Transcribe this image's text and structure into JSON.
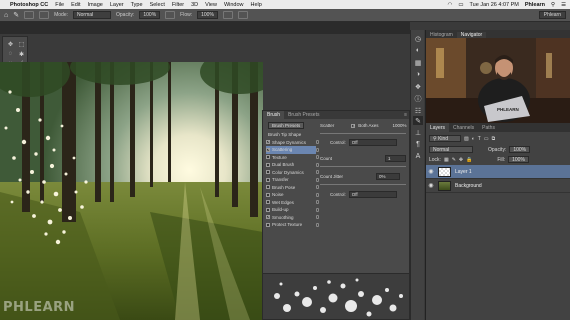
{
  "menubar": {
    "app_name": "Photoshop CC",
    "menus": [
      "File",
      "Edit",
      "Image",
      "Layer",
      "Type",
      "Select",
      "Filter",
      "3D",
      "View",
      "Window",
      "Help"
    ],
    "clock": "Tue Jan 26  4:07 PM",
    "user": "Phlearn"
  },
  "options": {
    "mode_label": "Mode:",
    "mode_value": "Normal",
    "opacity_label": "Opacity:",
    "opacity_value": "100%",
    "flow_label": "Flow:",
    "flow_value": "100%",
    "workspace": "Phlearn"
  },
  "navigator": {
    "tabs": [
      "Histogram",
      "Navigator"
    ],
    "laptop_text": "PHLEARN"
  },
  "layers_panel": {
    "tabs": [
      "Layers",
      "Channels",
      "Paths"
    ],
    "kind_label": "Kind",
    "blend_mode": "Normal",
    "opacity_label": "Opacity:",
    "opacity_value": "100%",
    "lock_label": "Lock:",
    "fill_label": "Fill:",
    "fill_value": "100%",
    "layers": [
      {
        "name": "Layer 1",
        "selected": true
      },
      {
        "name": "Background",
        "selected": false
      }
    ]
  },
  "brush_panel": {
    "tabs": [
      "Brush",
      "Brush Presets"
    ],
    "presets_button": "Brush Presets",
    "items": [
      {
        "label": "Brush Tip Shape",
        "checkbox": false,
        "checked": false,
        "selected": false
      },
      {
        "label": "Shape Dynamics",
        "checkbox": true,
        "checked": true,
        "selected": false
      },
      {
        "label": "Scattering",
        "checkbox": true,
        "checked": true,
        "selected": true
      },
      {
        "label": "Texture",
        "checkbox": true,
        "checked": false,
        "selected": false
      },
      {
        "label": "Dual Brush",
        "checkbox": true,
        "checked": false,
        "selected": false
      },
      {
        "label": "Color Dynamics",
        "checkbox": true,
        "checked": false,
        "selected": false
      },
      {
        "label": "Transfer",
        "checkbox": true,
        "checked": false,
        "selected": false
      },
      {
        "label": "Brush Pose",
        "checkbox": true,
        "checked": false,
        "selected": false
      },
      {
        "label": "Noise",
        "checkbox": true,
        "checked": false,
        "selected": false
      },
      {
        "label": "Wet Edges",
        "checkbox": true,
        "checked": false,
        "selected": false
      },
      {
        "label": "Build-up",
        "checkbox": true,
        "checked": false,
        "selected": false
      },
      {
        "label": "Smoothing",
        "checkbox": true,
        "checked": true,
        "selected": false
      },
      {
        "label": "Protect Texture",
        "checkbox": true,
        "checked": false,
        "selected": false
      }
    ],
    "scatter_label": "Scatter",
    "both_axes_label": "Both Axes",
    "scatter_value": "1000%",
    "control_label": "Control:",
    "control_value": "Off",
    "count_label": "Count",
    "count_value": "1",
    "count_jitter_label": "Count Jitter",
    "count_jitter_value": "0%",
    "control2_label": "Control:",
    "control2_value": "Off"
  },
  "watermark": "PHLEARN",
  "colors": {
    "foreground": "#f4efc3",
    "background": "#ffffff",
    "selection_blue": "#6b86b1"
  }
}
